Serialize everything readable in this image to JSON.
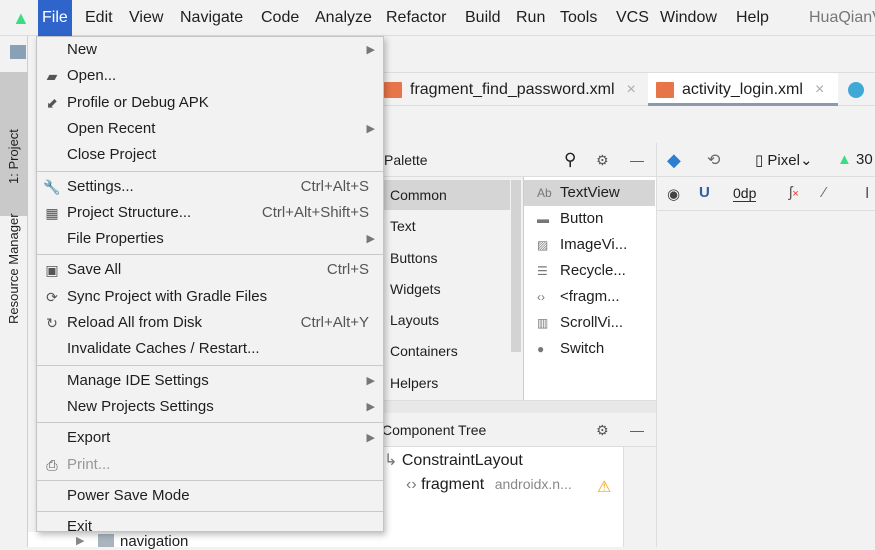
{
  "menubar": {
    "items": [
      "File",
      "Edit",
      "View",
      "Navigate",
      "Code",
      "Analyze",
      "Refactor",
      "Build",
      "Run",
      "Tools",
      "VCS",
      "Window",
      "Help"
    ],
    "project": "HuaQianV"
  },
  "sidebar": {
    "project_tab": "1: Project",
    "resource_manager": "Resource Manager"
  },
  "tabs": [
    {
      "label": "fragment_find_password.xml",
      "close": "×"
    },
    {
      "label": "activity_login.xml",
      "close": "×"
    }
  ],
  "palette": {
    "title": "Palette",
    "categories": [
      "Common",
      "Text",
      "Buttons",
      "Widgets",
      "Layouts",
      "Containers",
      "Helpers"
    ],
    "widgets": [
      {
        "icon": "Ab",
        "label": "TextView"
      },
      {
        "icon": "▬",
        "label": "Button"
      },
      {
        "icon": "▨",
        "label": "ImageVi..."
      },
      {
        "icon": "☰",
        "label": "Recycle..."
      },
      {
        "icon": "‹›",
        "label": "<fragm..."
      },
      {
        "icon": "▥",
        "label": "ScrollVi..."
      },
      {
        "icon": "●",
        "label": "Switch"
      }
    ]
  },
  "design_toolbar": {
    "device": "Pixel",
    "api": "30",
    "margin": "0dp"
  },
  "component_tree": {
    "title": "Component Tree",
    "root": "ConstraintLayout",
    "child": "fragment",
    "child_class": "androidx.n..."
  },
  "project_tree": {
    "visible_item": "navigation"
  },
  "file_menu": [
    {
      "label": "New",
      "arrow": true
    },
    {
      "label": "Open...",
      "icon": "folder-open-icon"
    },
    {
      "label": "Profile or Debug APK",
      "icon": "profile-apk-icon"
    },
    {
      "label": "Open Recent",
      "arrow": true
    },
    {
      "label": "Close Project"
    },
    {
      "sep": true
    },
    {
      "label": "Settings...",
      "shortcut": "Ctrl+Alt+S",
      "icon": "wrench-icon"
    },
    {
      "label": "Project Structure...",
      "shortcut": "Ctrl+Alt+Shift+S",
      "icon": "project-structure-icon"
    },
    {
      "label": "File Properties",
      "arrow": true
    },
    {
      "sep": true
    },
    {
      "label": "Save All",
      "shortcut": "Ctrl+S",
      "icon": "save-icon"
    },
    {
      "label": "Sync Project with Gradle Files",
      "icon": "gradle-sync-icon"
    },
    {
      "label": "Reload All from Disk",
      "shortcut": "Ctrl+Alt+Y",
      "icon": "reload-icon"
    },
    {
      "label": "Invalidate Caches / Restart..."
    },
    {
      "sep": true
    },
    {
      "label": "Manage IDE Settings",
      "arrow": true
    },
    {
      "label": "New Projects Settings",
      "arrow": true
    },
    {
      "sep": true
    },
    {
      "label": "Export",
      "arrow": true
    },
    {
      "label": "Print...",
      "disabled": true,
      "icon": "printer-icon"
    },
    {
      "sep": true
    },
    {
      "label": "Power Save Mode"
    },
    {
      "sep": true
    },
    {
      "label": "Exit"
    }
  ]
}
